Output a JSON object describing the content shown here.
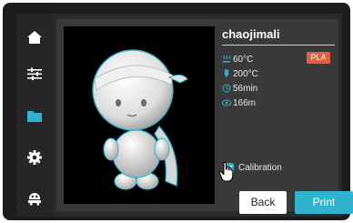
{
  "sidebar": {
    "items": [
      {
        "icon": "home-icon"
      },
      {
        "icon": "sliders-icon"
      },
      {
        "icon": "folder-icon"
      },
      {
        "icon": "gear-icon"
      },
      {
        "icon": "robot-icon"
      }
    ]
  },
  "file": {
    "name": "chaojimali",
    "material": "PLA",
    "bed_temp": "60°C",
    "nozzle_temp": "200°C",
    "time": "56min",
    "length": "166m"
  },
  "calibration": {
    "label": "Calibration",
    "checked": true
  },
  "buttons": {
    "back": "Back",
    "print": "Print"
  },
  "colors": {
    "accent": "#2fb3cf",
    "badge": "#ea5d3a",
    "active_nav": "#2fb3cf"
  }
}
